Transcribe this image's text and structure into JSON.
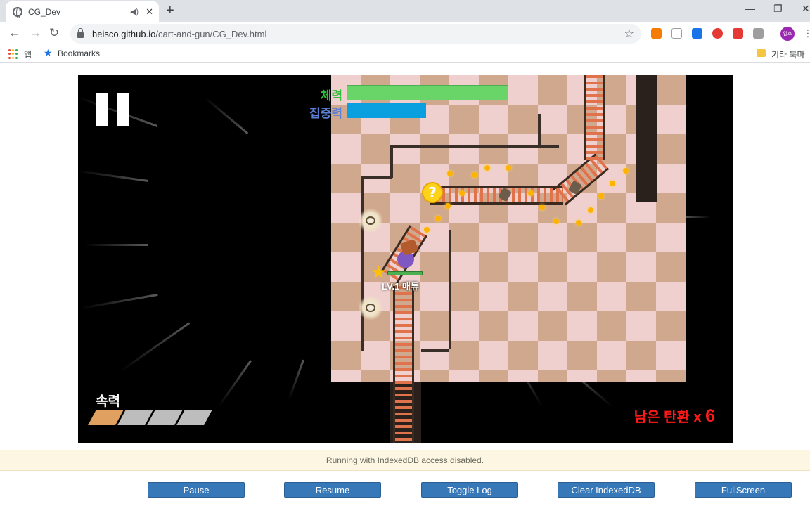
{
  "browser": {
    "tab_title": "CG_Dev",
    "url_host": "heisco.github.io",
    "url_path": "/cart-and-gun/CG_Dev.html",
    "bookmarks": {
      "apps_label": "앱",
      "bookmarks_label": "Bookmarks",
      "other_label": "기타 북마크"
    },
    "profile_label": "일호"
  },
  "game": {
    "hud": {
      "hp_label": "체력",
      "hp_color": "#2fbf3a",
      "hp_level": 1.0,
      "focus_label": "집중력",
      "focus_color": "#5b7fd6",
      "focus_level": 0.49,
      "speed_label": "속력",
      "speed_level": 1,
      "speed_max": 4,
      "ammo_label": "남은 탄환 x",
      "ammo_count": "6"
    },
    "player_label": "LV.1 매튜",
    "item_icon": "?"
  },
  "footer": {
    "notice": "Running with IndexedDB access disabled.",
    "buttons": {
      "pause": "Pause",
      "resume": "Resume",
      "toggle_log": "Toggle Log",
      "clear_db": "Clear IndexedDB",
      "fullscreen": "FullScreen"
    }
  }
}
